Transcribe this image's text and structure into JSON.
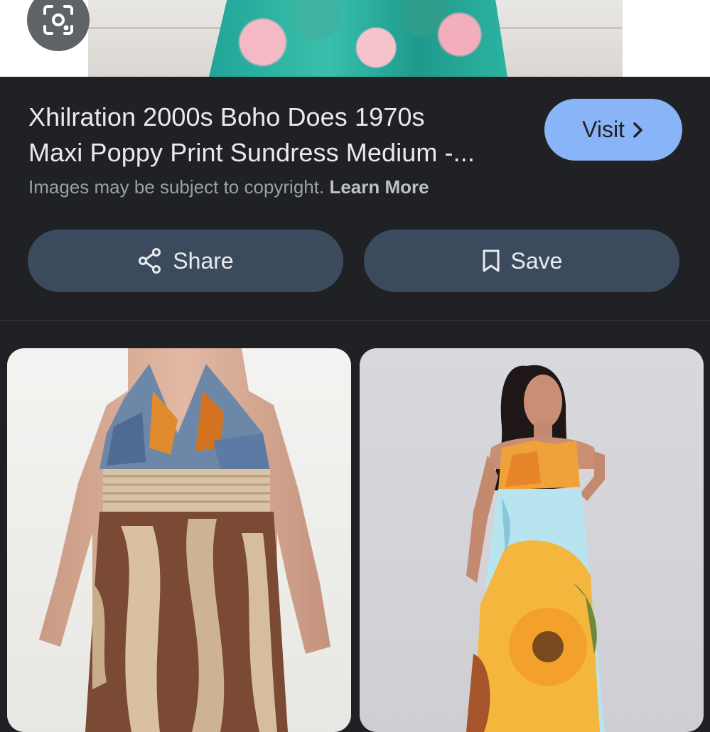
{
  "hero": {
    "lens_icon": "camera-search-icon"
  },
  "result": {
    "title_line1": "Xhilration 2000s Boho Does 1970s",
    "title_line2": "Maxi Poppy Print Sundress Medium -...",
    "visit_label": "Visit",
    "visit_icon": "chevron-right-icon",
    "copyright_text": "Images may be subject to copyright.",
    "learn_more_label": "Learn More"
  },
  "actions": {
    "share_label": "Share",
    "share_icon": "share-icon",
    "save_label": "Save",
    "save_icon": "bookmark-icon"
  },
  "colors": {
    "background": "#202124",
    "visit_button": "#8ab4f8",
    "action_button": "#3c4a5e",
    "text_primary": "#e8eaed",
    "text_secondary": "#9aa0a6"
  }
}
